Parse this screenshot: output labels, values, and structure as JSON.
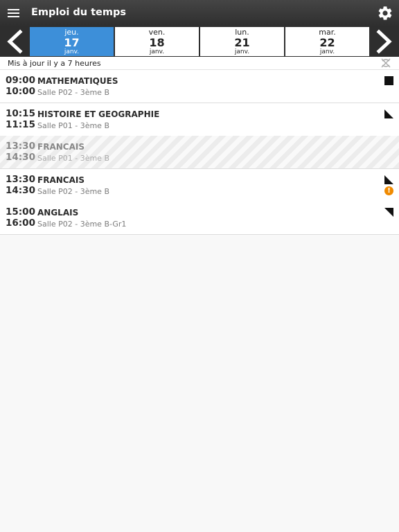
{
  "app": {
    "title": "Emploi du temps",
    "menu_icon": "hamburger-menu-icon",
    "settings_icon": "gear-icon"
  },
  "colors": {
    "accent": "#3d8fd9",
    "appbar": "#3a3a3a",
    "warning": "#f08a00"
  },
  "days": [
    {
      "name": "jeu.",
      "num": "17",
      "month": "janv.",
      "active": true
    },
    {
      "name": "ven.",
      "num": "18",
      "month": "janv.",
      "active": false
    },
    {
      "name": "lun.",
      "num": "21",
      "month": "janv.",
      "active": false
    },
    {
      "name": "mar.",
      "num": "22",
      "month": "janv.",
      "active": false
    }
  ],
  "status": {
    "text": "Mis à jour il y a 7 heures",
    "icon": "sync-off-icon"
  },
  "lessons": [
    {
      "start": "09:00",
      "end": "10:00",
      "subject": "MATHEMATIQUES",
      "room": "Salle P02 - 3ème B",
      "marker": "square-icon"
    },
    {
      "start": "10:15",
      "end": "11:15",
      "subject": "HISTOIRE ET GEOGRAPHIE",
      "room": "Salle P01 - 3ème B",
      "marker": "corner-bottom-right-icon"
    },
    {
      "start": "13:30",
      "end": "14:30",
      "subject": "FRANCAIS",
      "room": "Salle P01 - 3ème B",
      "marker": "",
      "cancelled": true
    },
    {
      "start": "13:30",
      "end": "14:30",
      "subject": "FRANCAIS",
      "room": "Salle P02 - 3ème B",
      "marker": "corner-bottom-right-icon",
      "warning": "!"
    },
    {
      "start": "15:00",
      "end": "16:00",
      "subject": "ANGLAIS",
      "room": "Salle P02 - 3ème B-Gr1",
      "marker": "corner-top-right-icon"
    }
  ]
}
